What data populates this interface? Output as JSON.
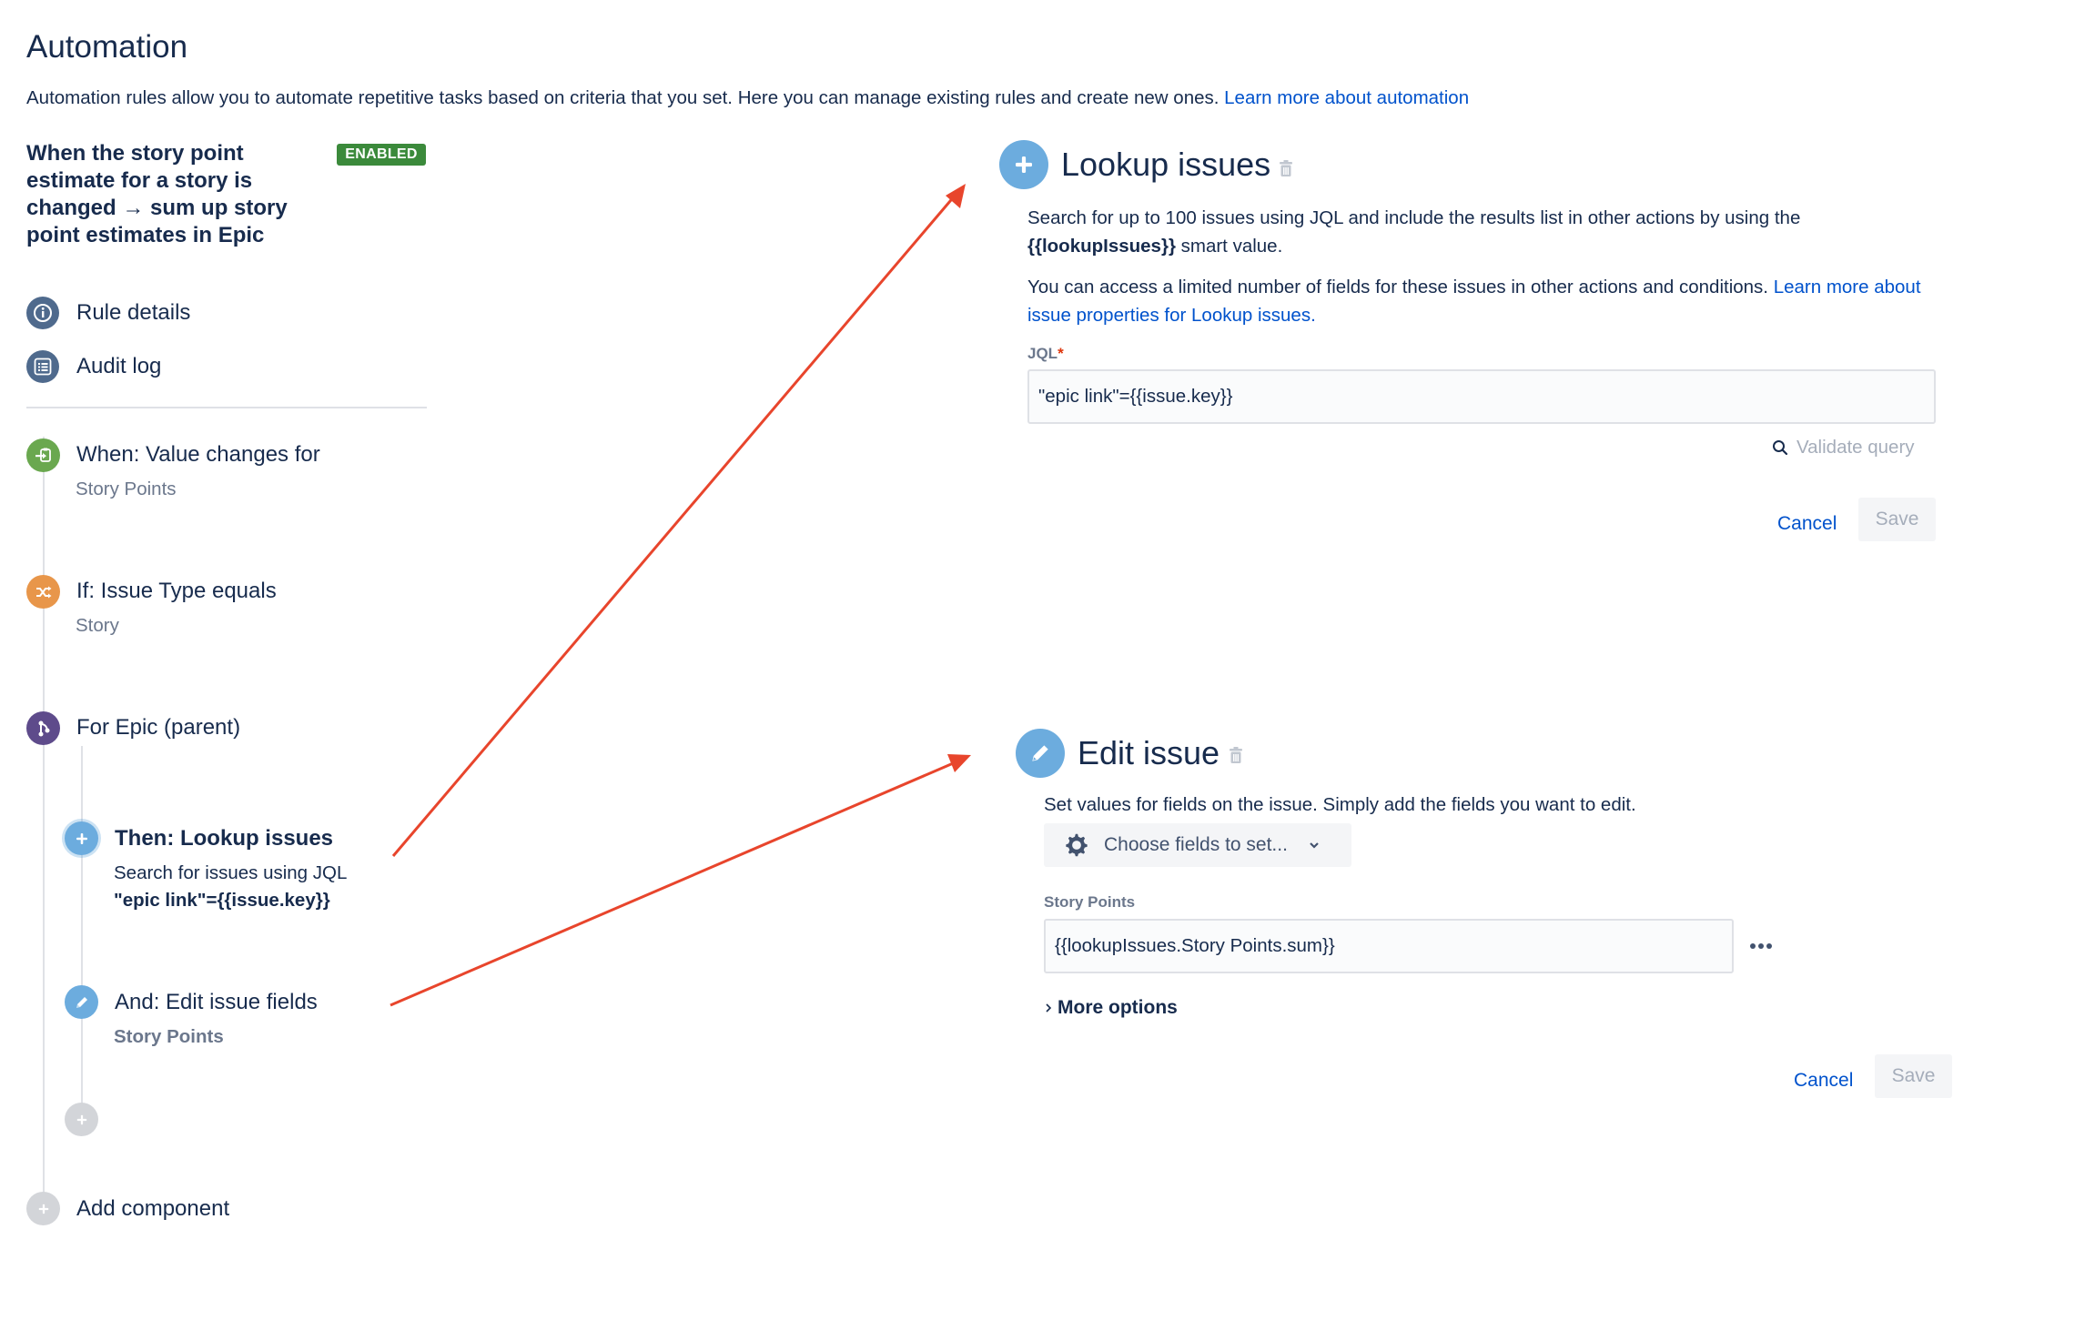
{
  "header": {
    "title": "Automation",
    "description": "Automation rules allow you to automate repetitive tasks based on criteria that you set. Here you can manage existing rules and create new ones. ",
    "learn_more_link": "Learn more about automation"
  },
  "rule": {
    "title": "When the story point estimate for a story is changed → sum up story point estimates in Epic",
    "status_badge": "ENABLED"
  },
  "sidebar_nav": [
    {
      "label": "Rule details",
      "icon": "info-icon"
    },
    {
      "label": "Audit log",
      "icon": "list-icon"
    }
  ],
  "steps": {
    "trigger": {
      "title": "When: Value changes for",
      "subtitle": "Story Points",
      "icon": "field-change-icon",
      "color": "#6aa84f"
    },
    "condition": {
      "title": "If: Issue Type equals",
      "subtitle": "Story",
      "icon": "shuffle-icon",
      "color": "#e8964a"
    },
    "branch": {
      "title": "For Epic (parent)",
      "icon": "branch-icon",
      "color": "#5e4b8b"
    },
    "lookup": {
      "title": "Then: Lookup issues",
      "subtitle_line1": "Search for issues using JQL",
      "subtitle_line2": "\"epic link\"={{issue.key}}",
      "icon": "plus-icon",
      "color": "#6cacde"
    },
    "edit": {
      "title": "And: Edit issue fields",
      "subtitle": "Story Points",
      "icon": "pencil-icon",
      "color": "#6cacde"
    },
    "add_nested": {
      "icon": "plus-icon"
    },
    "add_component": {
      "label": "Add component",
      "icon": "plus-icon"
    }
  },
  "lookup_panel": {
    "title": "Lookup issues",
    "desc1_prefix": "Search for up to 100 issues using JQL and include the results list in other actions by using the",
    "desc1_smart_value": "{{lookupIssues}}",
    "desc1_suffix": " smart value.",
    "desc2": "You can access a limited number of fields for these issues in other actions and conditions. ",
    "desc2_link": "Learn more about issue properties for Lookup issues.",
    "jql_label": "JQL",
    "required_mark": "*",
    "jql_value": "\"epic link\"={{issue.key}}",
    "validate_label": "Validate query",
    "cancel_label": "Cancel",
    "save_label": "Save"
  },
  "edit_panel": {
    "title": "Edit issue",
    "description": "Set values for fields on the issue. Simply add the fields you want to edit.",
    "choose_fields_label": "Choose fields to set...",
    "field_label": "Story Points",
    "field_value": "{{lookupIssues.Story Points.sum}}",
    "more_options_label": "More options",
    "cancel_label": "Cancel",
    "save_label": "Save"
  },
  "annotation_color": "#e8452c"
}
